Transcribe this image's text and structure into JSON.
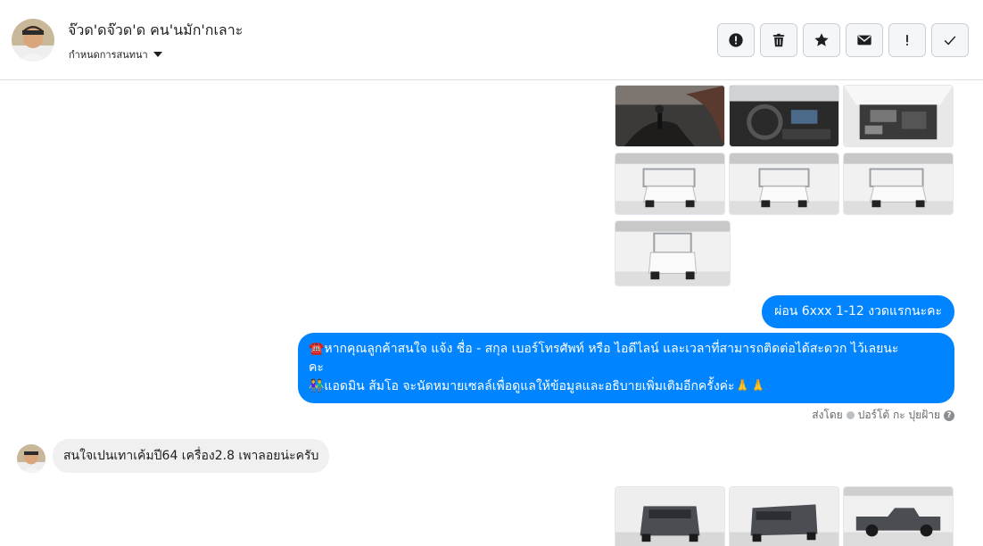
{
  "header": {
    "contact_name": "จ๊วด'ดจ๊วด'ด คน'นมัก'กเลาะ",
    "settings_label": "กำหนดการสนทนา",
    "actions": [
      "spam-report",
      "delete",
      "star",
      "mark-unread",
      "important",
      "done"
    ]
  },
  "thread": {
    "messages": [
      {
        "from": "page",
        "text": "ผ่อน 6xxx 1-12 งวดแรกนะคะ"
      },
      {
        "from": "page",
        "lines": [
          "☎️หากคุณลูกค้าสนใจ แจ้ง ชื่อ - สกุล เบอร์โทรศัพท์ หรือ ไอดีไลน์ และเวลาที่สามารถติดต่อได้สะดวก ไว้เลยนะ",
          "คะ",
          "👫แอดมิน ส้มโอ จะนัดหมายเซลล์เพื่อดูแลให้ข้อมูลและอธิบายเพิ่มเติมอีกครั้งค่ะ🙏🙏"
        ]
      },
      {
        "from": "customer",
        "text": "สนใจเปนเทาเค้มปี64 เครื่อง2.8 เพาลอยน่ะครับ"
      }
    ],
    "sent_by_label": "ส่งโดย",
    "sent_by_name": "ปอร์โต้ กะ ปุยฝ้าย",
    "help_glyph": "?"
  },
  "colors": {
    "outgoing_bubble": "#0084ff",
    "incoming_bubble": "#f0f0f0",
    "border": "#dddfe2"
  }
}
